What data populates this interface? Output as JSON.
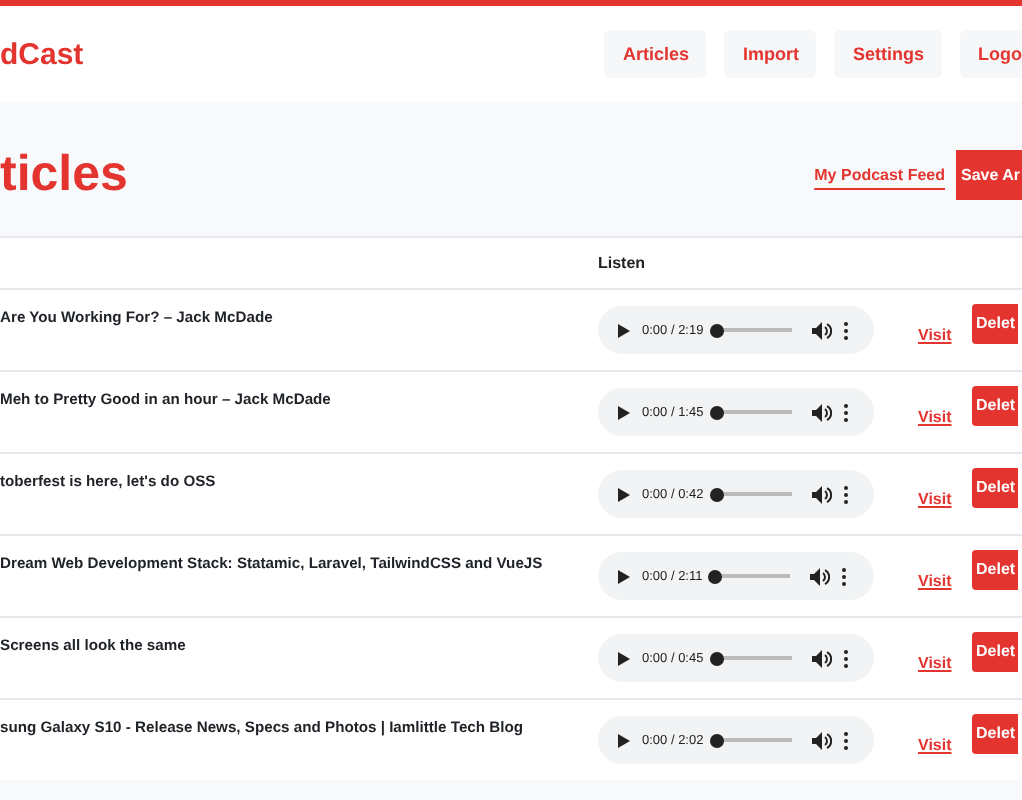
{
  "header": {
    "logo": "dCast",
    "nav": [
      {
        "label": "Articles"
      },
      {
        "label": "Import"
      },
      {
        "label": "Settings"
      },
      {
        "label": "Logo"
      }
    ]
  },
  "page": {
    "title": "ticles",
    "feed_link": "My Podcast Feed",
    "save_button": "Save Ar"
  },
  "table": {
    "columns": [
      "Listen"
    ],
    "rows": [
      {
        "title": "Are You Working For? – Jack McDade",
        "time": "0:00 / 2:19",
        "level": 0,
        "visit": "Visit",
        "delete": "Delet"
      },
      {
        "title": "Meh to Pretty Good in an hour – Jack McDade",
        "time": "0:00 / 1:45",
        "level": 0,
        "visit": "Visit",
        "delete": "Delet"
      },
      {
        "title": "toberfest is here, let's do OSS",
        "time": "0:00 / 0:42",
        "level": 0,
        "visit": "Visit",
        "delete": "Delet"
      },
      {
        "title": "Dream Web Development Stack: Statamic, Laravel, TailwindCSS and VueJS",
        "time": "0:00 / 2:11",
        "level": 0,
        "visit": "Visit",
        "delete": "Delet"
      },
      {
        "title": "Screens all look the same",
        "time": "0:00 / 0:45",
        "level": 0,
        "visit": "Visit",
        "delete": "Delet"
      },
      {
        "title": "sung Galaxy S10 - Release News, Specs and Photos | Iamlittle Tech Blog",
        "time": "0:00 / 2:02",
        "level": 0,
        "visit": "Visit",
        "delete": "Delet"
      }
    ]
  }
}
